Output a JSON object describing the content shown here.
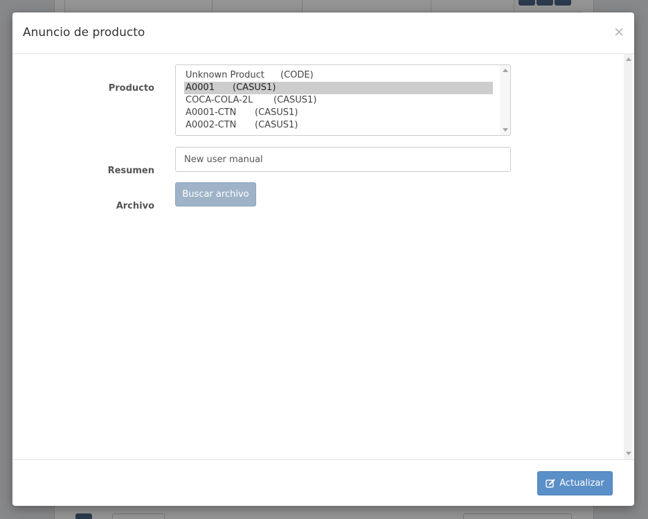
{
  "modal": {
    "title": "Anuncio de producto",
    "close_symbol": "×"
  },
  "form": {
    "product_label": "Producto",
    "summary_label": "Resumen",
    "file_label": "Archivo",
    "summary_value": "New user manual",
    "browse_button_label": "Buscar archivo"
  },
  "products": [
    {
      "name": "Unknown Product",
      "code": "(CODE)",
      "selected": false
    },
    {
      "name": "A0001",
      "code": "(CASUS1)",
      "selected": true
    },
    {
      "name": "COCA-COLA-2L",
      "code": "(CASUS1)",
      "selected": false
    },
    {
      "name": "A0001-CTN",
      "code": "(CASUS1)",
      "selected": false
    },
    {
      "name": "A0002-CTN",
      "code": "(CASUS1)",
      "selected": false
    }
  ],
  "footer": {
    "update_button_label": "Actualizar",
    "update_icon": "edit-icon"
  },
  "colors": {
    "primary": "#5b8fc7",
    "disabled_button": "#9fb3c8",
    "selected_row": "#cdcdcd"
  }
}
